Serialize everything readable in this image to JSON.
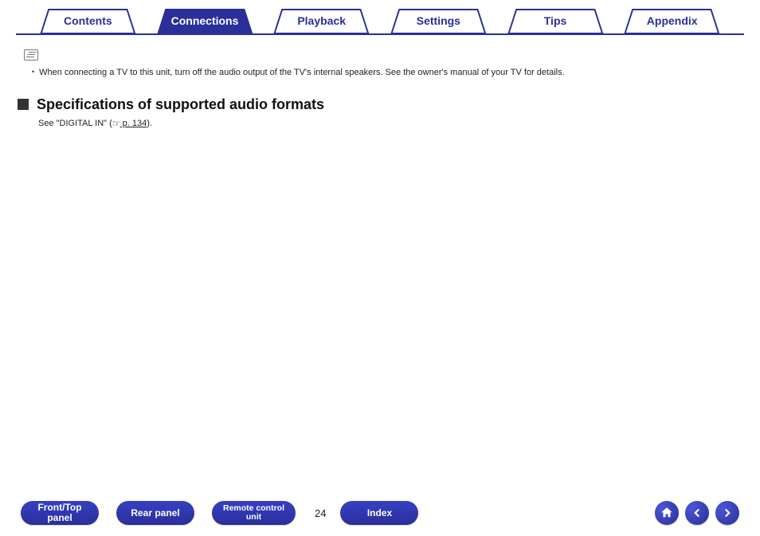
{
  "tabs": {
    "items": [
      {
        "label": "Contents",
        "active": false
      },
      {
        "label": "Connections",
        "active": true
      },
      {
        "label": "Playback",
        "active": false
      },
      {
        "label": "Settings",
        "active": false
      },
      {
        "label": "Tips",
        "active": false
      },
      {
        "label": "Appendix",
        "active": false
      }
    ]
  },
  "note": {
    "bullet1": "When connecting a TV to this unit, turn off the audio output of the TV's internal speakers. See the owner's manual of your TV for details."
  },
  "heading": {
    "title": "Specifications of supported audio formats",
    "sub_pre": "See \"DIGITAL IN\" (",
    "sub_link": " p. 134",
    "sub_post": ")."
  },
  "footer": {
    "front_top_panel": "Front/Top panel",
    "rear_panel": "Rear panel",
    "remote_control_unit": "Remote control unit",
    "index": "Index",
    "page": "24",
    "icons": {
      "home": "home-icon",
      "prev": "arrow-left-icon",
      "next": "arrow-right-icon"
    }
  },
  "colors": {
    "brand": "#2a2f9a"
  }
}
